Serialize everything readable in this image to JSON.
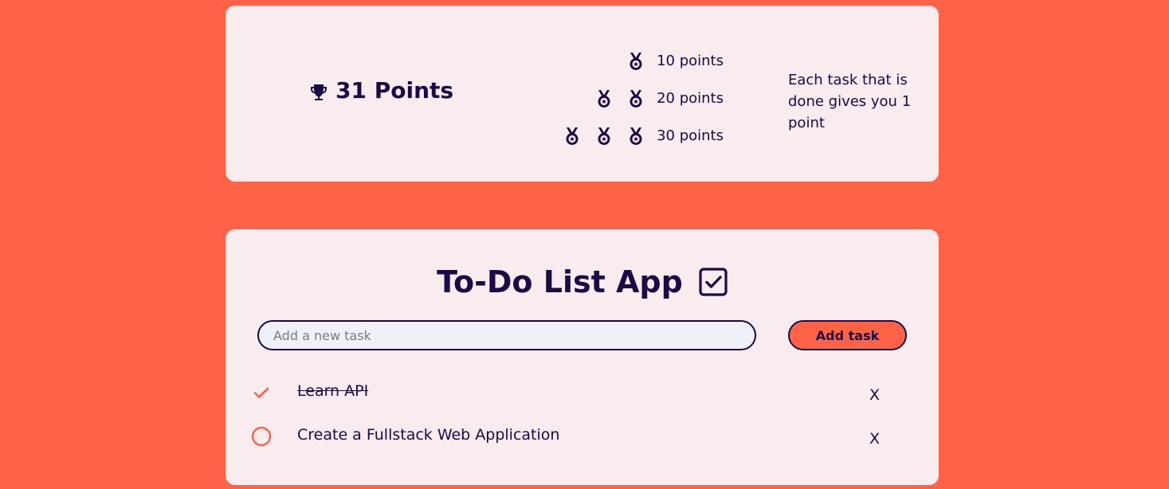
{
  "points": {
    "total_label": "31 Points",
    "levels": [
      {
        "medals": 1,
        "label": "10 points"
      },
      {
        "medals": 2,
        "label": "20 points"
      },
      {
        "medals": 3,
        "label": "30 points"
      }
    ],
    "explanation": "Each task that is done gives you 1 point"
  },
  "todo": {
    "title": "To-Do List App",
    "input_placeholder": "Add a new task",
    "input_value": "",
    "add_button_label": "Add task",
    "tasks": [
      {
        "text": "Learn API",
        "done": true,
        "delete_label": "X"
      },
      {
        "text": "Create a Fullstack Web Application",
        "done": false,
        "delete_label": "X"
      }
    ]
  },
  "colors": {
    "background": "#ff6347",
    "card": "#f8ecef",
    "text": "#1a0a45",
    "accent": "#ff6347"
  },
  "icons": {
    "trophy": "trophy-icon",
    "medal": "medal-icon",
    "title_check": "checkbox-checked-icon",
    "task_done": "checkmark-icon",
    "task_open": "circle-icon"
  }
}
